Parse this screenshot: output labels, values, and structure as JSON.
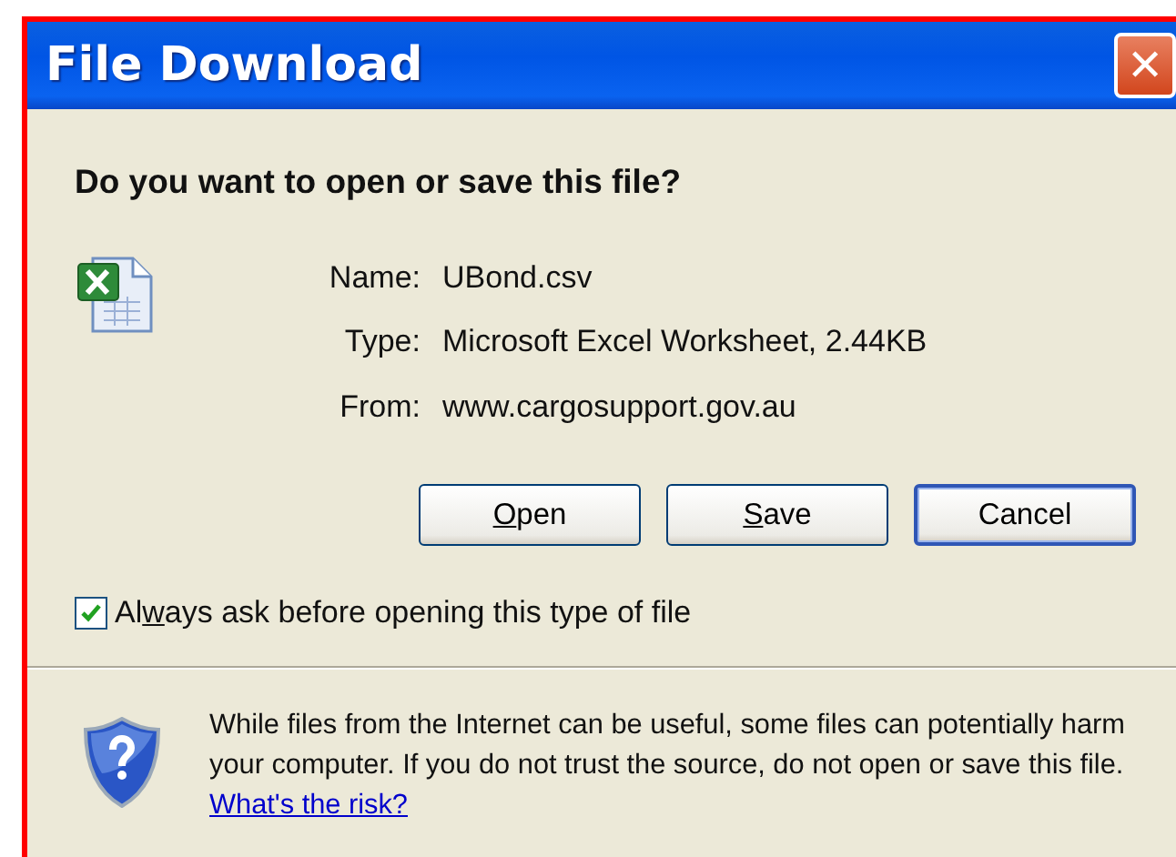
{
  "window": {
    "title": "File Download",
    "close_symbol": "✕"
  },
  "question": "Do you want to open or save this file?",
  "file_info": [
    {
      "label": "Name:",
      "value": "UBond.csv"
    },
    {
      "label": "Type:",
      "value": "Microsoft Excel Worksheet, 2.44KB"
    },
    {
      "label": "From:",
      "value": "www.cargosupport.gov.au"
    }
  ],
  "buttons": [
    {
      "access_key": "O",
      "after": "pen",
      "default": false
    },
    {
      "access_key": "S",
      "after": "ave",
      "default": false
    },
    {
      "before": "Cancel",
      "default": true
    }
  ],
  "always_ask": {
    "before": "Al",
    "access_key": "w",
    "after": "ays ask before opening this type of file",
    "checked": true
  },
  "warning": {
    "text": "While files from the Internet can be useful, some files can potentially harm your computer. If you do not trust the source, do not open or save this file.",
    "link": "What's the risk?"
  }
}
